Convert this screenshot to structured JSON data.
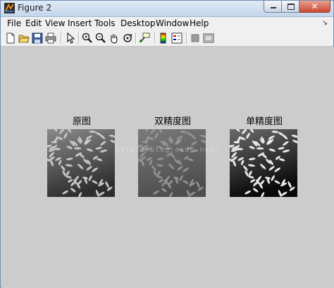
{
  "window": {
    "title": "Figure 2",
    "icons": {
      "app": "matlab-figure-icon",
      "minimize": "minimize-icon",
      "maximize": "maximize-icon",
      "close": "close-icon"
    },
    "close_glyph": "✕"
  },
  "menubar": {
    "items": [
      "File",
      "Edit",
      "View",
      "Insert",
      "Tools",
      "Desktop",
      "Window",
      "Help"
    ],
    "overflow_glyph": "↘"
  },
  "toolbar": {
    "icons": [
      "new-figure-icon",
      "open-file-icon",
      "save-icon",
      "print-icon",
      "edit-plot-arrow-icon",
      "zoom-in-icon",
      "zoom-out-icon",
      "pan-hand-icon",
      "rotate-3d-icon",
      "data-cursor-icon",
      "brush-icon",
      "link-icon",
      "colorbar-icon",
      "legend-icon",
      "hide-plot-tools-icon",
      "show-plot-tools-icon"
    ]
  },
  "figure": {
    "background": "#cccccc",
    "subplots": [
      {
        "title": "原图",
        "style": "original"
      },
      {
        "title": "双精度图",
        "style": "double"
      },
      {
        "title": "单精度图",
        "style": "single"
      }
    ],
    "watermark": "http://blog.csdn.net/"
  }
}
